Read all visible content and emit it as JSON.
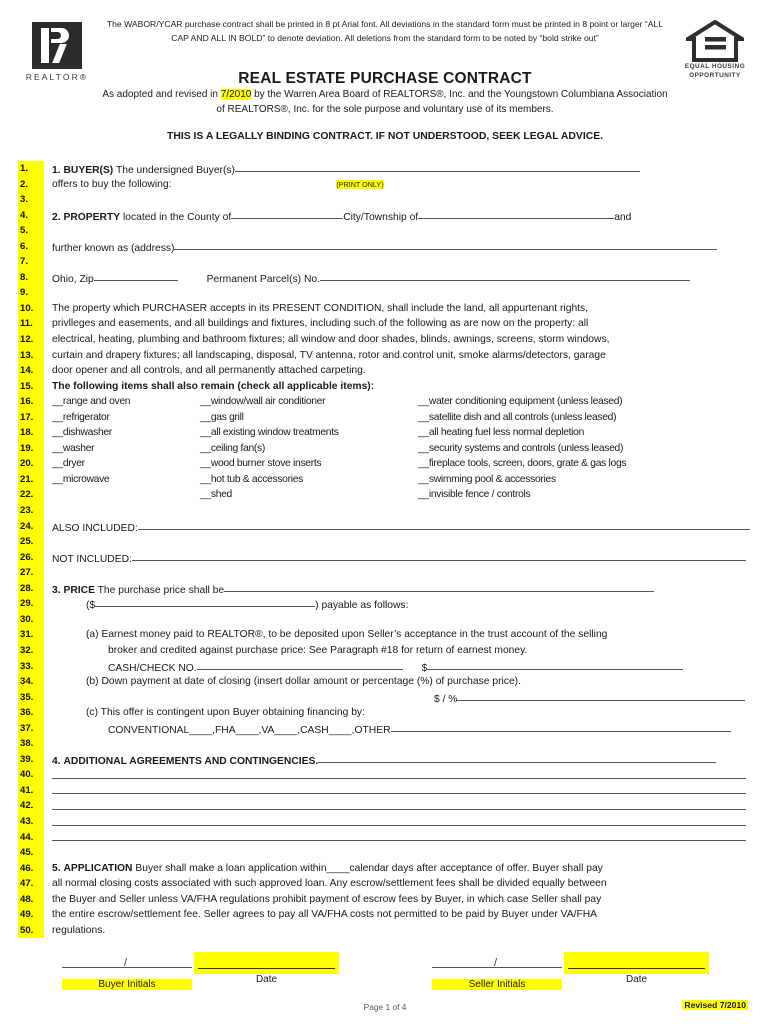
{
  "header": {
    "realtor_logo_label": "REALTOR®",
    "print_note": "The WABOR/YCAR purchase contract shall be printed in 8 pt Arial font.  All deviations in the standard form must be printed in 8 point or larger “ALL CAP AND ALL IN BOLD” to denote deviation.  All deletions from the standard form to be noted by “bold strike out”",
    "title": "REAL ESTATE PURCHASE CONTRACT",
    "adopted_prefix": "As adopted and revised in ",
    "revision_date": "7/2010",
    "adopted_suffix": " by the Warren Area Board of REALTORS®, Inc. and the Youngstown Columbiana Association of REALTORS®, Inc. for the sole purpose and voluntary use of its members.",
    "binding_notice": "THIS IS A LEGALLY BINDING CONTRACT.  IF NOT UNDERSTOOD, SEEK LEGAL ADVICE.",
    "eho_line1": "EQUAL HOUSING",
    "eho_line2": "OPPORTUNITY"
  },
  "line_numbers": [
    "1.",
    "2.",
    "3.",
    "4.",
    "5.",
    "6.",
    "7.",
    "8.",
    "9.",
    "10.",
    "11.",
    "12.",
    "13.",
    "14.",
    "15.",
    "16.",
    "17.",
    "18.",
    "19.",
    "20.",
    "21.",
    "22.",
    "23.",
    "24.",
    "25.",
    "26.",
    "27.",
    "28.",
    "29.",
    "30.",
    "31.",
    "32.",
    "33.",
    "34.",
    "35.",
    "36.",
    "37.",
    "38.",
    "39.",
    "40.",
    "41.",
    "42.",
    "43.",
    "44.",
    "45.",
    "46.",
    "47.",
    "48.",
    "49.",
    "50."
  ],
  "section1": {
    "number": "1.",
    "heading": "BUYER(S)",
    "text": "The undersigned Buyer(s)",
    "line2": "offers to buy the following:",
    "print_only": "(PRINT ONLY)"
  },
  "section2": {
    "number": "2.",
    "heading": "PROPERTY",
    "located_in": "located in the County of",
    "city_township": "City/Township of",
    "and": "and",
    "further_known": "further known as (address)",
    "ohio_zip": "Ohio, Zip",
    "parcel": "Permanent Parcel(s) No."
  },
  "condition_paragraph": [
    "The property which PURCHASER accepts in its PRESENT CONDITION, shall include the land, all appurtenant rights,",
    "privlleges and easements, and all buildings and fixtures, including such of the following as are now on the property: all",
    "electrical, heating, plumbing and bathroom fixtures; all window and door shades, blinds, awnings, screens, storm windows,",
    "curtain and drapery fixtures; all landscaping, disposal, TV antenna, rotor and control unit, smoke alarms/detectors, garage",
    "door opener and all controls, and all permanently attached carpeting."
  ],
  "items_heading": "The following items shall also remain (check all applicable items):",
  "items_column_1": [
    "__range and oven",
    "__refrigerator",
    "__dishwasher",
    "__washer",
    "__dryer",
    "__microwave"
  ],
  "items_column_2": [
    "__window/wall air conditioner",
    "__gas grill",
    "__all existing window treatments",
    "__ceiling fan(s)",
    "__wood burner stove inserts",
    "__hot tub & accessories",
    "__shed"
  ],
  "items_column_3": [
    "__water conditioning equipment (unless leased)",
    "__satellite dish and all controls (unless leased)",
    "__all heating fuel less normal depletion",
    "__security systems and controls (unless leased)",
    "__fireplace tools, screen, doors, grate & gas logs",
    "__swimming pool & accessories",
    "__invisible fence / controls"
  ],
  "also_included_label": "ALSO INCLUDED:",
  "not_included_label": "NOT INCLUDED:",
  "section3": {
    "number": "3.",
    "heading": "PRICE",
    "text": "The purchase price shall be",
    "dollar_open": "($",
    "payable": ") payable as follows:",
    "item_a": "(a) Earnest money paid to REALTOR®, to be deposited upon Seller’s acceptance in the trust account of the selling",
    "item_a2": "broker and credited against purchase price:  See Paragraph #18 for return of earnest money.",
    "cash_check": "CASH/CHECK NO.",
    "dollar_sign": "$",
    "item_b": "(b) Down payment at date of closing (insert dollar amount or percentage (%) of purchase price).",
    "dollar_percent": "$ / %",
    "item_c": "(c) This offer is contingent upon Buyer obtaining financing by:",
    "financing_options": "CONVENTIONAL____,FHA____,VA____,CASH____,OTHER"
  },
  "section4": {
    "number": "4.",
    "heading": "ADDITIONAL AGREEMENTS AND CONTINGENCIES."
  },
  "section5": {
    "number": "5.",
    "heading": "APPLICATION",
    "lines": [
      "Buyer shall make a loan application within____calendar days after acceptance of offer.  Buyer shall pay",
      "all normal closing costs associated with such approved loan.  Any escrow/settlement fees shall be divided equally between",
      "the Buyer and Seller unless VA/FHA regulations prohibit payment of escrow fees by Buyer, in which case Seller shall pay",
      "the entire escrow/settlement fee.  Seller agrees to pay all VA/FHA costs not permitted to be paid by Buyer under VA/FHA",
      "regulations."
    ]
  },
  "footer": {
    "buyer_initials_label": "Buyer Initials",
    "buyer_date_label": "Date",
    "seller_initials_label": "Seller Initials",
    "seller_date_label": "Date",
    "slash": "/",
    "page_of": "Page 1 of 4",
    "revised": "Revised 7/2010"
  },
  "colors": {
    "highlight": "#ffff00",
    "text": "#1a1a1a",
    "rule": "#555555"
  }
}
